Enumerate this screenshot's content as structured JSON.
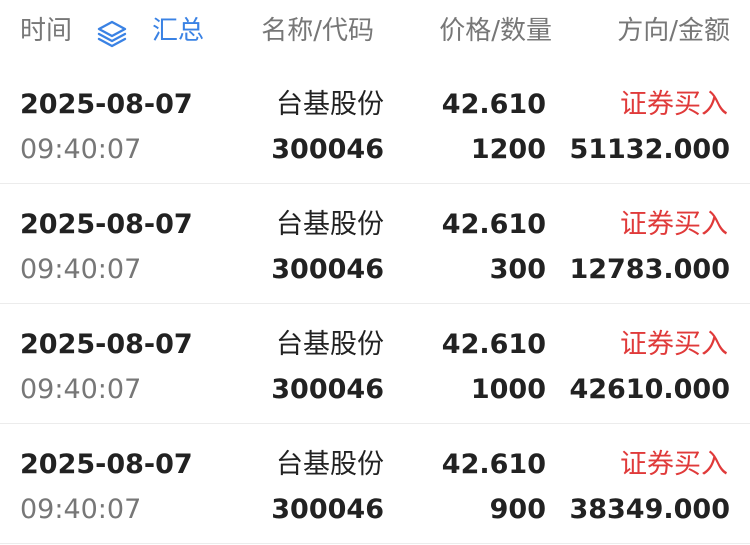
{
  "header": {
    "time_label": "时间",
    "summary_icon": "layers-icon",
    "summary_label": "汇总",
    "name_label": "名称/代码",
    "price_label": "价格/数量",
    "direction_label": "方向/金额"
  },
  "colors": {
    "accent_blue": "#3a82e4",
    "buy_red": "#e03a3a"
  },
  "rows": [
    {
      "date": "2025-08-07",
      "time": "09:40:07",
      "name": "台基股份",
      "code": "300046",
      "price": "42.610",
      "qty": "1200",
      "direction": "证券买入",
      "amount": "51132.000"
    },
    {
      "date": "2025-08-07",
      "time": "09:40:07",
      "name": "台基股份",
      "code": "300046",
      "price": "42.610",
      "qty": "300",
      "direction": "证券买入",
      "amount": "12783.000"
    },
    {
      "date": "2025-08-07",
      "time": "09:40:07",
      "name": "台基股份",
      "code": "300046",
      "price": "42.610",
      "qty": "1000",
      "direction": "证券买入",
      "amount": "42610.000"
    },
    {
      "date": "2025-08-07",
      "time": "09:40:07",
      "name": "台基股份",
      "code": "300046",
      "price": "42.610",
      "qty": "900",
      "direction": "证券买入",
      "amount": "38349.000"
    }
  ]
}
